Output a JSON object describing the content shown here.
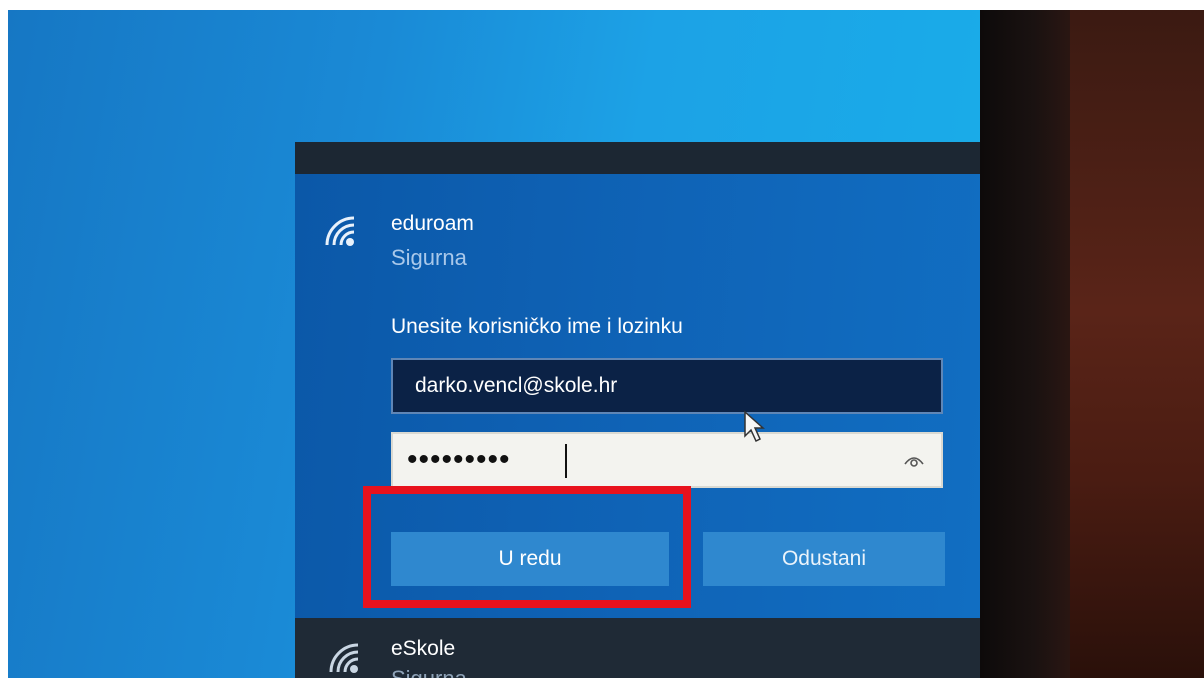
{
  "network_list": {
    "selected": {
      "name": "eduroam",
      "status": "Sigurna",
      "icon": "wifi-icon",
      "prompt": "Unesite korisničko ime i lozinku",
      "username_value": "darko.vencl@skole.hr",
      "password_masked": "•••••••••",
      "password_reveal_icon": "eye-icon",
      "ok_label": "U redu",
      "cancel_label": "Odustani"
    },
    "next": {
      "name": "eSkole",
      "status": "Sigurna",
      "icon": "wifi-icon"
    }
  },
  "annotation": {
    "highlight_color": "#e8121d",
    "highlighted_element": "U redu"
  },
  "colors": {
    "flyout_expanded_bg": "#0f63b6",
    "flyout_dark_bg": "#1f2a36",
    "button_bg": "#2f88cf",
    "username_field_bg": "#0b2246",
    "password_field_bg": "#f3f3ef"
  }
}
